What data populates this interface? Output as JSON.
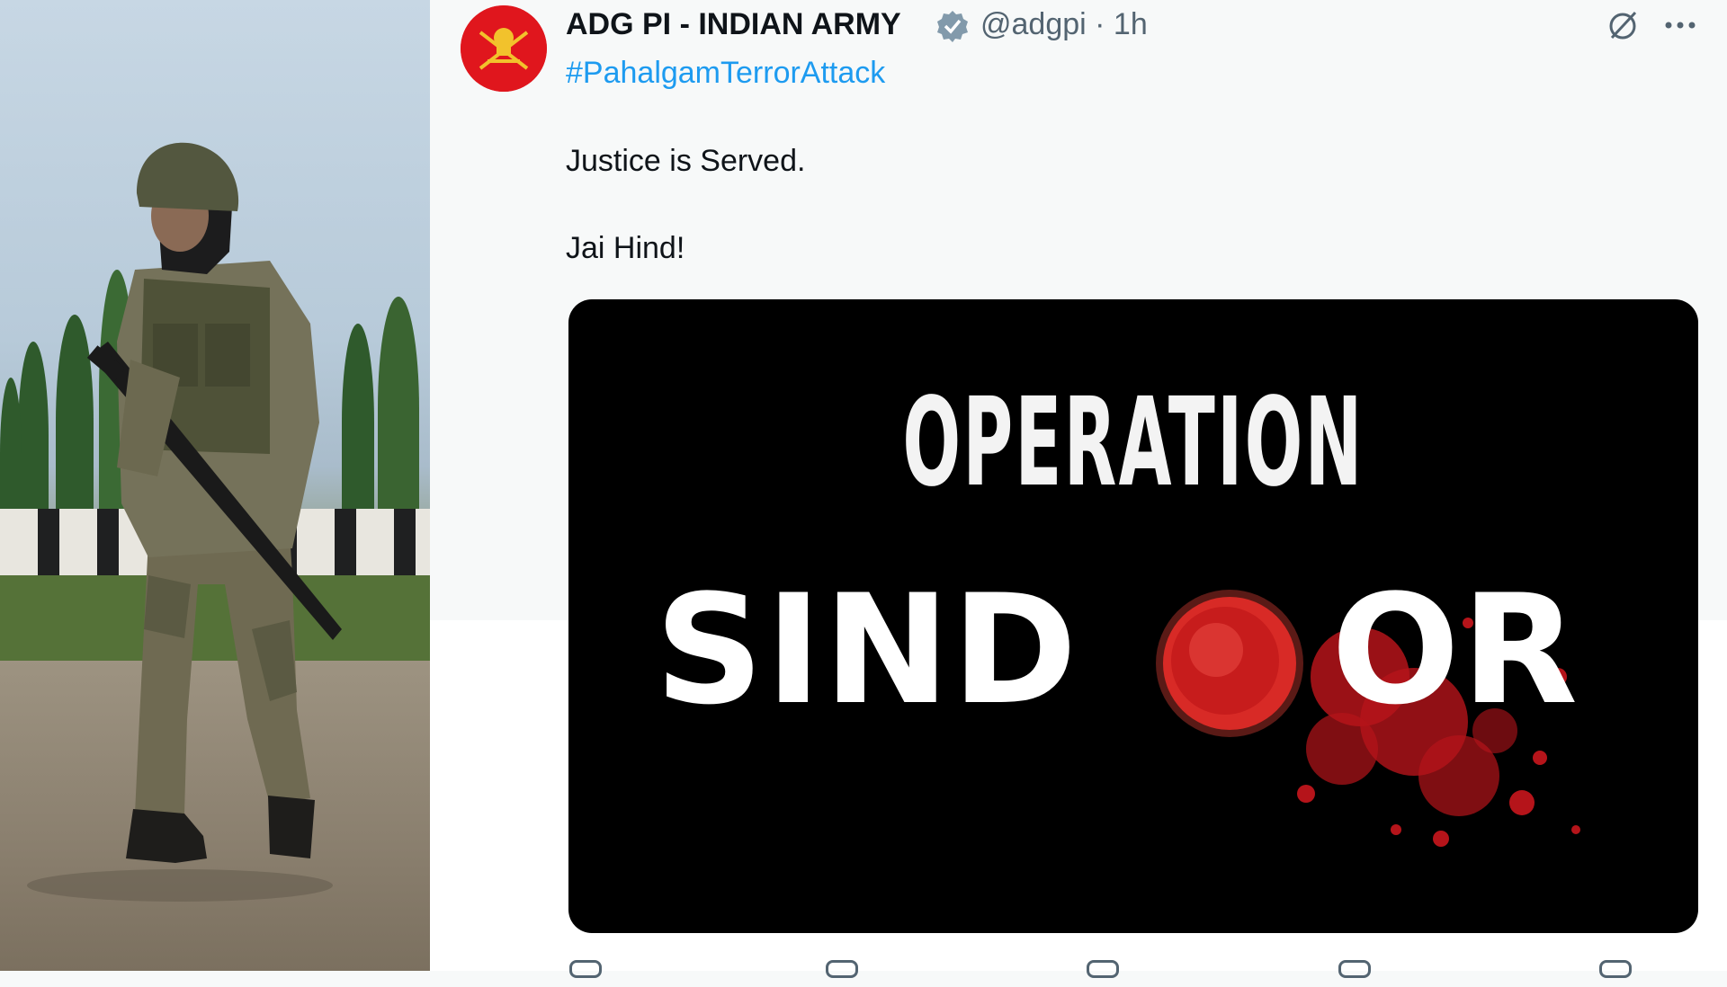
{
  "tweet": {
    "display_name": "ADG PI - INDIAN ARMY",
    "handle_time": "@adgpi · 1h",
    "hashtag": "#PahalgamTerrorAttack",
    "lines": [
      "Justice is Served.",
      "Jai Hind!"
    ],
    "media": {
      "line1": "OPERATION",
      "line2_left": "SIND",
      "line2_right": "OR"
    }
  },
  "icons": {
    "verified": "verified-badge-icon",
    "grok": "grok-icon",
    "more": "more-options-icon",
    "reply": "reply-icon",
    "retweet": "retweet-icon",
    "like": "like-icon",
    "views": "views-icon",
    "bookmark": "bookmark-icon"
  },
  "colors": {
    "accent": "#1d9bf0",
    "avatar_red": "#e0161d",
    "sindoor_red": "#c4151c"
  }
}
